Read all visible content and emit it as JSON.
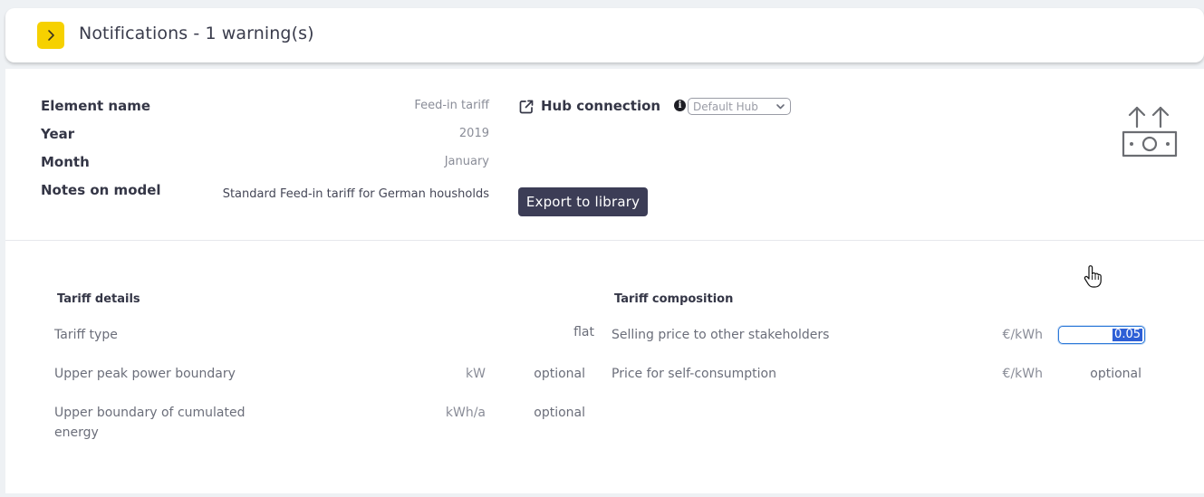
{
  "notifications": {
    "title": "Notifications - 1 warning(s)",
    "toggle_icon": "chevron-right-icon",
    "accent": "#f6d100"
  },
  "meta": {
    "element_name_label": "Element name",
    "element_name_value": "Feed-in tariff",
    "year_label": "Year",
    "year_value": "2019",
    "month_label": "Month",
    "month_value": "January",
    "notes_label": "Notes on model",
    "notes_value": "Standard Feed-in tariff for German housholds"
  },
  "hub": {
    "label": "Hub connection",
    "link_icon": "external-link-icon",
    "info_icon": "info-icon",
    "select_value": "Default Hub"
  },
  "export_button": {
    "label": "Export to library",
    "color": "#3c3d56"
  },
  "element_icon": "money-upload-icon",
  "tariff_details": {
    "heading": "Tariff details",
    "rows": [
      {
        "label": "Tariff type",
        "unit": "",
        "value": "flat"
      },
      {
        "label": "Upper peak power boundary",
        "unit": "kW",
        "value": "optional"
      },
      {
        "label": "Upper boundary of cumulated energy",
        "unit": "kWh/a",
        "value": "optional"
      }
    ]
  },
  "tariff_composition": {
    "heading": "Tariff composition",
    "rows": [
      {
        "label": "Selling price to other stakeholders",
        "unit": "€/kWh",
        "value": "0.05"
      },
      {
        "label": "Price for self-consumption",
        "unit": "€/kWh",
        "value": "optional"
      }
    ],
    "selection_color": "#2e5fd6"
  }
}
